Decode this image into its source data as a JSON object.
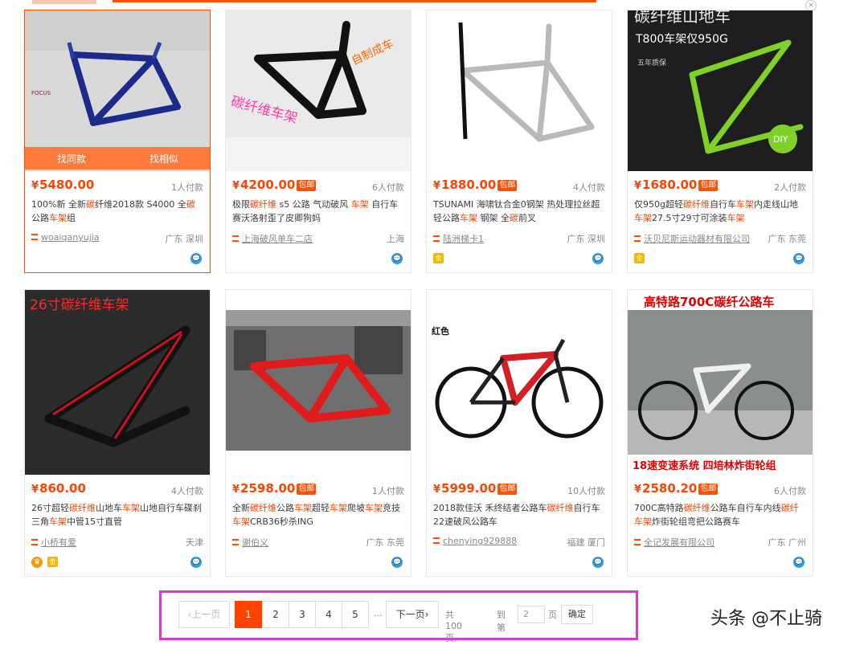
{
  "top_banner": {
    "close_label": "×"
  },
  "products": [
    {
      "price": "5480.00",
      "free_shipping": "",
      "buyers": "1人付款",
      "title_parts": [
        {
          "t": "100%新 全新",
          "h": false
        },
        {
          "t": "碳",
          "h": true
        },
        {
          "t": "纤维2018款 S",
          "h": false
        },
        {
          "t": "",
          "h": false
        },
        {
          "t": "4000 全",
          "h": false
        },
        {
          "t": "碳",
          "h": true
        },
        {
          "t": "公路",
          "h": false
        },
        {
          "t": "车架",
          "h": true
        },
        {
          "t": "组",
          "h": false
        }
      ],
      "shop": "woaiqanyujia",
      "location": "广东 深圳",
      "hover_actions": [
        "找同款",
        "找相似"
      ],
      "badges": []
    },
    {
      "price": "4200.00",
      "free_shipping": "包邮",
      "buyers": "6人付款",
      "title_parts": [
        {
          "t": "极限",
          "h": false
        },
        {
          "t": "碳纤维",
          "h": true
        },
        {
          "t": " s5 公路 气动破风 ",
          "h": false
        },
        {
          "t": "车架",
          "h": true
        },
        {
          "t": " 自行车赛沃洛射歪了皮卿狗妈",
          "h": false
        }
      ],
      "shop": "上海破风单车二店",
      "location": "上海",
      "badges": []
    },
    {
      "price": "1880.00",
      "free_shipping": "包邮",
      "buyers": "4人付款",
      "title_parts": [
        {
          "t": "TSUNAMI 海啸钛合金0钢架 热处理拉丝超轻公路",
          "h": false
        },
        {
          "t": "车架",
          "h": true
        },
        {
          "t": " 钢架 全",
          "h": false
        },
        {
          "t": "碳",
          "h": true
        },
        {
          "t": "前叉",
          "h": false
        }
      ],
      "shop": "陆洲梯卡1",
      "location": "广东 深圳",
      "badges": [
        "gold"
      ]
    },
    {
      "price": "1680.00",
      "free_shipping": "包邮",
      "buyers": "2人付款",
      "title_parts": [
        {
          "t": "仅950g超轻",
          "h": false
        },
        {
          "t": "碳纤维",
          "h": true
        },
        {
          "t": "自行车",
          "h": false
        },
        {
          "t": "车架",
          "h": true
        },
        {
          "t": "内走线山地",
          "h": false
        },
        {
          "t": "车架",
          "h": true
        },
        {
          "t": "27.5寸29寸可涂装",
          "h": false
        },
        {
          "t": "车架",
          "h": true
        }
      ],
      "shop": "沃贝尼斯运动器材有限公司",
      "location": "广东 东莞",
      "badges": [
        "gold"
      ],
      "image_text": {
        "headline": "碳纤维山地车",
        "sub": "T800车架仅950G",
        "warranty": "五年质保",
        "diy": "DIY"
      }
    },
    {
      "price": "860.00",
      "free_shipping": "",
      "buyers": "4人付款",
      "title_parts": [
        {
          "t": "26寸超轻",
          "h": false
        },
        {
          "t": "碳纤维",
          "h": true
        },
        {
          "t": "山地车",
          "h": false
        },
        {
          "t": "车架",
          "h": true
        },
        {
          "t": "山地自行车碟刹三角",
          "h": false
        },
        {
          "t": "车架",
          "h": true
        },
        {
          "t": "中管15寸直管",
          "h": false
        }
      ],
      "shop": "小桥有爱",
      "location": "天津",
      "badges": [
        "crown",
        "gold"
      ],
      "image_text": {
        "headline": "26寸碳纤维车架"
      }
    },
    {
      "price": "2598.00",
      "free_shipping": "包邮",
      "buyers": "1人付款",
      "title_parts": [
        {
          "t": "全新",
          "h": false
        },
        {
          "t": "碳纤维",
          "h": true
        },
        {
          "t": "公路",
          "h": false
        },
        {
          "t": "车架",
          "h": true
        },
        {
          "t": "超轻",
          "h": false
        },
        {
          "t": "车架",
          "h": true
        },
        {
          "t": "爬坡",
          "h": false
        },
        {
          "t": "车架",
          "h": true
        },
        {
          "t": "竞技",
          "h": false
        },
        {
          "t": "车架",
          "h": true
        },
        {
          "t": "CRB36秒杀ING",
          "h": false
        }
      ],
      "shop": "谢伯义",
      "location": "广东 东莞",
      "badges": []
    },
    {
      "price": "5999.00",
      "free_shipping": "包邮",
      "buyers": "10人付款",
      "title_parts": [
        {
          "t": "2018款佳沃 禾终结者公路车",
          "h": false
        },
        {
          "t": "碳",
          "h": true
        },
        {
          "t": "纤维",
          "h": true
        },
        {
          "t": "自行车22速破风公路车",
          "h": false
        }
      ],
      "shop": "chenying929888",
      "location": "福建 厦门",
      "badges": [],
      "image_text": {
        "headline": "红色"
      }
    },
    {
      "price": "2580.20",
      "free_shipping": "包邮",
      "buyers": "6人付款",
      "title_parts": [
        {
          "t": "700C高特路",
          "h": false
        },
        {
          "t": "碳纤维",
          "h": true
        },
        {
          "t": "公路车自行车内线",
          "h": false
        },
        {
          "t": "碳纤",
          "h": true
        },
        {
          "t": "车架",
          "h": true
        },
        {
          "t": "炸街轮组弯把公路赛车",
          "h": false
        }
      ],
      "shop": "全记发展有限公司",
      "location": "广东 广州",
      "badges": [],
      "image_text": {
        "headline": "高特路700C碳纤公路车",
        "footer": "18速变速系统 四培林炸街轮组"
      }
    }
  ],
  "pagination": {
    "prev": "上一页",
    "pages": [
      "1",
      "2",
      "3",
      "4",
      "5"
    ],
    "active": "1",
    "ellipsis": "...",
    "next": "下一页",
    "total": "共 100 页,",
    "goto": "到第",
    "goto_value": "2",
    "page_unit": "页",
    "confirm": "确定"
  },
  "watermark": "头条 @不止骑"
}
